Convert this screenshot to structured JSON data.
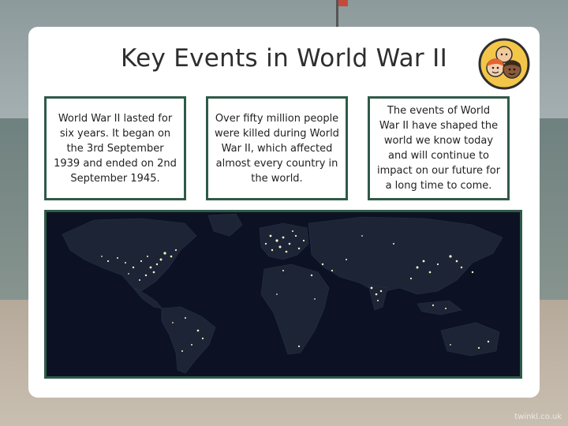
{
  "title": "Key Events in World War II",
  "boxes": [
    {
      "text": "World War II lasted for six years. It began on the 3rd September 1939 and ended on 2nd September 1945."
    },
    {
      "text": "Over fifty million people were killed during World War II, which affected almost every country in the world."
    },
    {
      "text": "The events of World War II have shaped the world we know today and will continue to impact on our future for a long time to come."
    }
  ],
  "footer": "twinkl.co.uk",
  "colors": {
    "border": "#2f5a48",
    "card": "#ffffff",
    "map_bg": "#0c1224"
  }
}
